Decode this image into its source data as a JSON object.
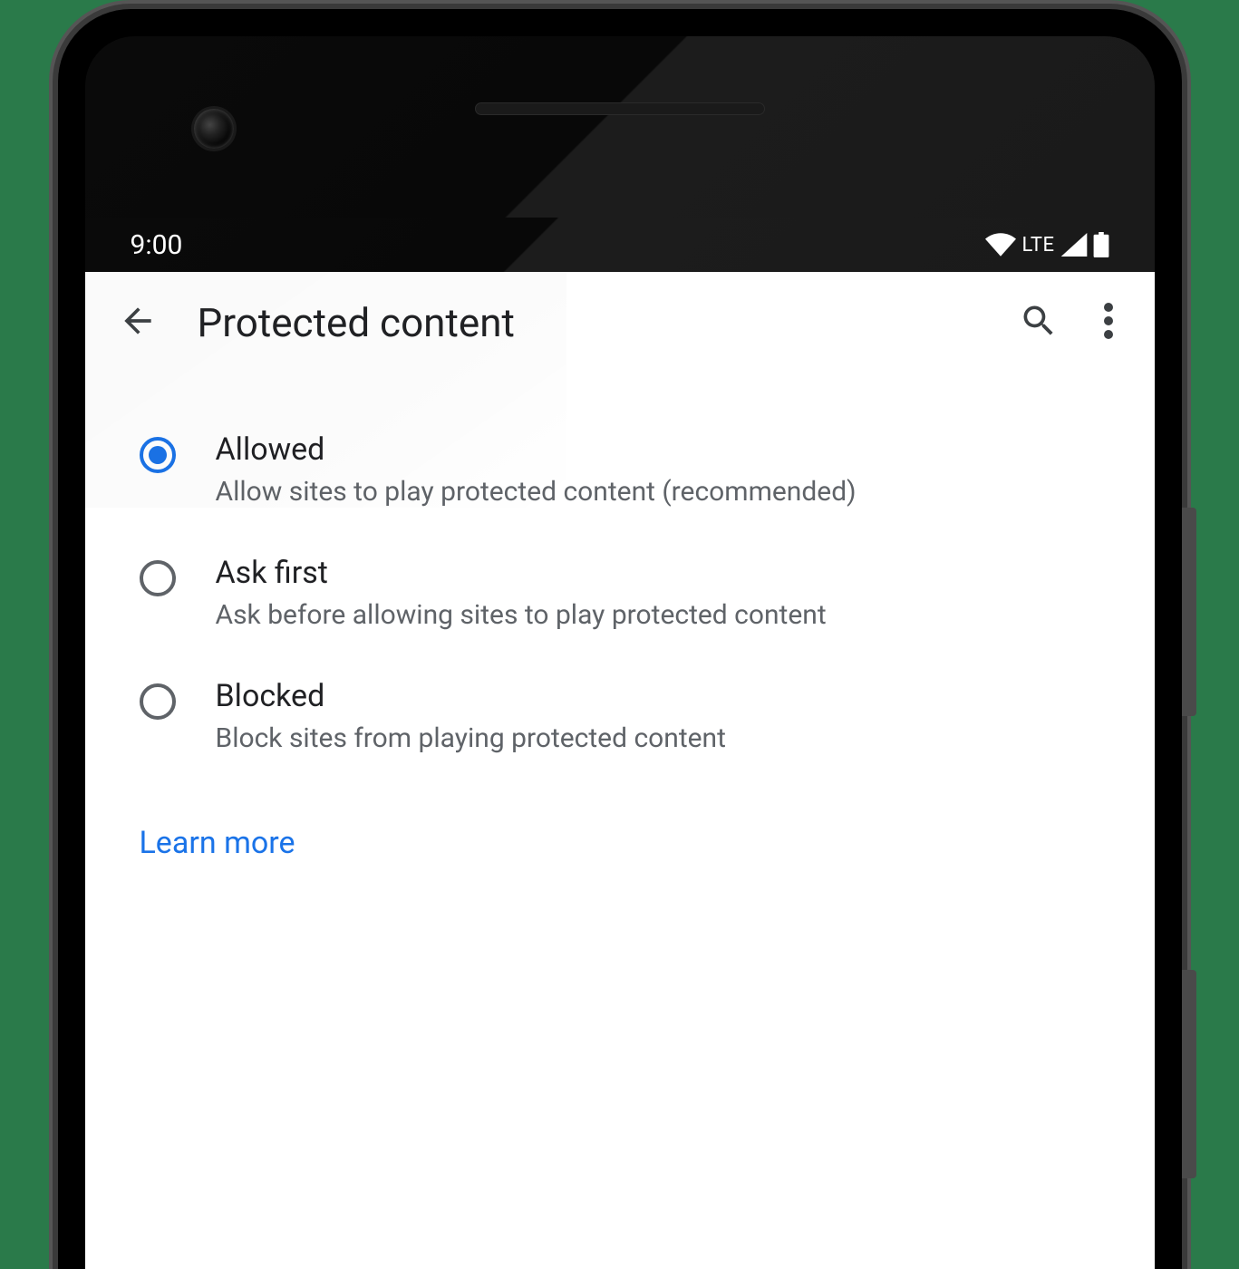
{
  "status_bar": {
    "time": "9:00",
    "network_label": "LTE"
  },
  "app_bar": {
    "title": "Protected content"
  },
  "options": [
    {
      "title": "Allowed",
      "description": "Allow sites to play protected content (recommended)",
      "selected": true
    },
    {
      "title": "Ask first",
      "description": "Ask before allowing sites to play protected content",
      "selected": false
    },
    {
      "title": "Blocked",
      "description": "Block sites from playing protected content",
      "selected": false
    }
  ],
  "learn_more_label": "Learn more"
}
